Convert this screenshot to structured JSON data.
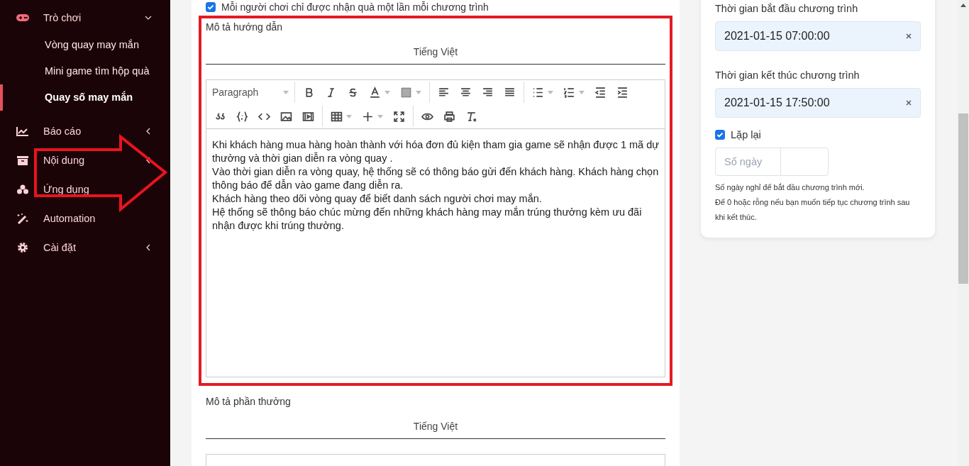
{
  "sidebar": {
    "items": [
      {
        "label": "Trò chơi",
        "kind": "group",
        "expanded": true,
        "children": [
          {
            "label": "Vòng quay may mắn",
            "selected": false
          },
          {
            "label": "Mini game tìm hộp quà",
            "selected": false
          },
          {
            "label": "Quay số may mắn",
            "selected": true
          }
        ]
      },
      {
        "label": "Báo cáo",
        "kind": "group",
        "expanded": false
      },
      {
        "label": "Nội dung",
        "kind": "group",
        "expanded": false
      },
      {
        "label": "Ứng dụng",
        "kind": "link"
      },
      {
        "label": "Automation",
        "kind": "link"
      },
      {
        "label": "Cài đặt",
        "kind": "group",
        "expanded": false
      }
    ]
  },
  "main": {
    "top_checkbox": {
      "label": "Mỗi người chơi chỉ được nhận quà một lần mỗi chương trình",
      "checked": true
    },
    "editors": [
      {
        "label": "Mô tả hướng dẫn",
        "language_tab": "Tiếng Việt",
        "block_format": "Paragraph",
        "highlighted": true,
        "paragraphs": [
          "Khi khách hàng mua hàng hoàn thành với hóa đơn đủ kiện tham gia game sẽ nhận được 1 mã dự thưởng và thời gian diễn ra vòng quay .",
          "Vào thời gian diễn ra vòng quay, hệ thống sẽ có thông báo gửi đến khách hàng. Khách hàng chọn thông báo để dẫn vào game đang diễn ra.",
          "Khách hàng theo dõi vòng quay để biết danh sách người chơi may mắn.",
          "Hệ thống sẽ thông báo chúc mừng đến những khách hàng may mắn trúng thưởng kèm ưu đãi nhận được khi trúng thưởng."
        ]
      },
      {
        "label": "Mô tả phần thưởng",
        "language_tab": "Tiếng Việt",
        "highlighted": false
      }
    ]
  },
  "schedule": {
    "fields": [
      {
        "label": "Thời gian bắt đầu chương trình",
        "value": "2021-01-15 07:00:00"
      },
      {
        "label": "Thời gian kết thúc chương trình",
        "value": "2021-01-15 17:50:00"
      }
    ],
    "repeat": {
      "label": "Lặp lại",
      "checked": true
    },
    "days_input": {
      "placeholder": "Số ngày"
    },
    "help": [
      "Số ngày nghỉ để bắt đầu chương trình mới.",
      "Để 0 hoặc rỗng nếu bạn muốn tiếp tục chương trình sau khi kết thúc."
    ]
  }
}
